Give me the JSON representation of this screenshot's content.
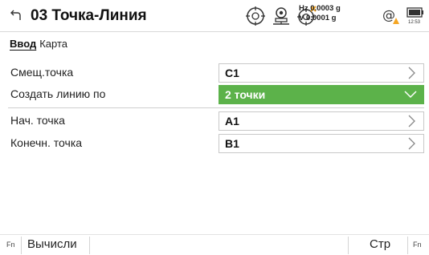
{
  "header": {
    "title": "03 Точка-Линия",
    "hz_line": "Hz 0.0003 g",
    "v_line": "V  0.0001 g",
    "battery_time": "12:53",
    "icons": [
      "back-arrow-icon",
      "target-prism-icon",
      "total-station-icon",
      "target-compensator-icon",
      "at-warning-icon",
      "battery-icon"
    ],
    "warning_color": "#f5a623"
  },
  "tabs": {
    "active": "Ввод",
    "inactive": "Карта"
  },
  "form": {
    "offset_point": {
      "label": "Смещ.точка",
      "value": "C1"
    },
    "create_line": {
      "label": "Создать линию по",
      "value": "2 точки",
      "accent": "#5cb24a"
    },
    "start_point": {
      "label": "Нач. точка",
      "value": "A1"
    },
    "end_point": {
      "label": "Конечн. точка",
      "value": "B1"
    }
  },
  "footer": {
    "fn_left": "Fn",
    "compute_label": "Вычисли",
    "page_label": "Стр",
    "fn_right": "Fn"
  }
}
